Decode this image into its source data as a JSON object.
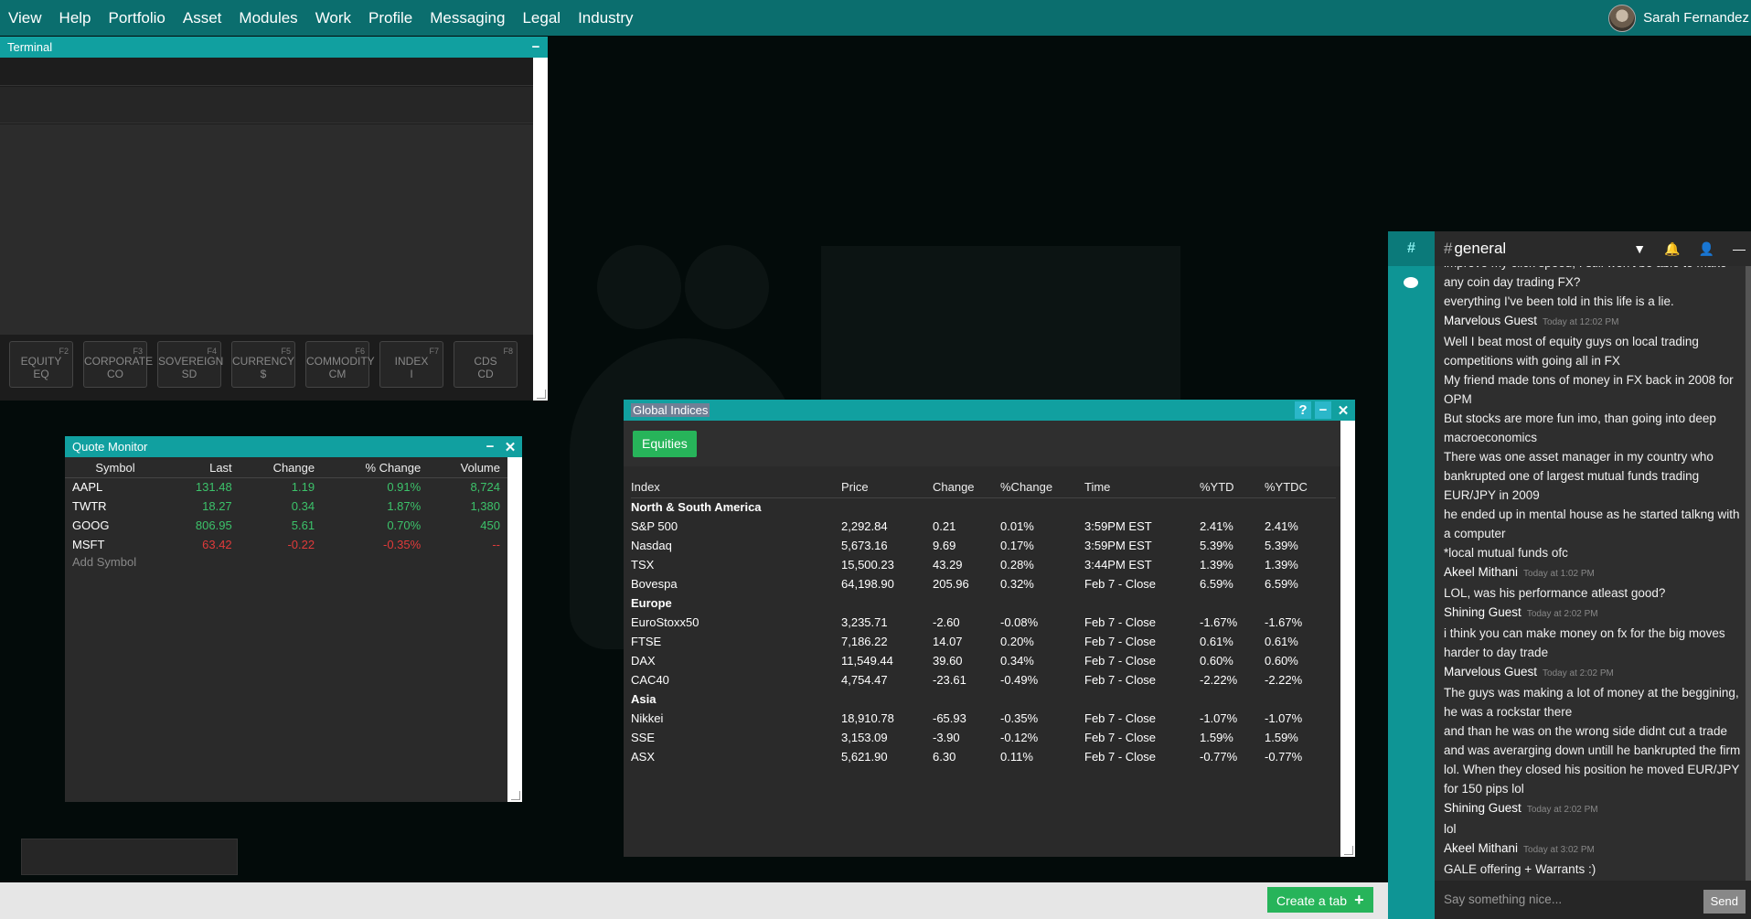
{
  "menu": [
    "View",
    "Help",
    "Portfolio",
    "Asset",
    "Modules",
    "Work",
    "Profile",
    "Messaging",
    "Legal",
    "Industry"
  ],
  "user": {
    "name": "Sarah Fernandez"
  },
  "terminal": {
    "title": "Terminal",
    "fkeys": [
      {
        "key": "F2",
        "line1": "EQUITY",
        "line2": "EQ"
      },
      {
        "key": "F3",
        "line1": "CORPORATE",
        "line2": "CO"
      },
      {
        "key": "F4",
        "line1": "SOVEREIGN",
        "line2": "SD"
      },
      {
        "key": "F5",
        "line1": "CURRENCY",
        "line2": "$"
      },
      {
        "key": "F6",
        "line1": "COMMODITY",
        "line2": "CM"
      },
      {
        "key": "F7",
        "line1": "INDEX",
        "line2": "I"
      },
      {
        "key": "F8",
        "line1": "CDS",
        "line2": "CD"
      }
    ]
  },
  "quote_monitor": {
    "title": "Quote Monitor",
    "columns": [
      "Symbol",
      "Last",
      "Change",
      "% Change",
      "Volume"
    ],
    "rows": [
      {
        "symbol": "AAPL",
        "last": "131.48",
        "change": "1.19",
        "pct": "0.91%",
        "volume": "8,724",
        "dir": "pos"
      },
      {
        "symbol": "TWTR",
        "last": "18.27",
        "change": "0.34",
        "pct": "1.87%",
        "volume": "1,380",
        "dir": "pos"
      },
      {
        "symbol": "GOOG",
        "last": "806.95",
        "change": "5.61",
        "pct": "0.70%",
        "volume": "450",
        "dir": "pos"
      },
      {
        "symbol": "MSFT",
        "last": "63.42",
        "change": "-0.22",
        "pct": "-0.35%",
        "volume": "--",
        "dir": "neg"
      }
    ],
    "add_symbol": "Add Symbol"
  },
  "global_indices": {
    "title": "Global Indices",
    "tab": "Equities",
    "columns": [
      "Index",
      "Price",
      "Change",
      "%Change",
      "Time",
      "%YTD",
      "%YTDC"
    ],
    "groups": [
      {
        "region": "North & South America",
        "rows": [
          {
            "name": "S&P 500",
            "price": "2,292.84",
            "change": "0.21",
            "pct": "0.01%",
            "time": "3:59PM EST",
            "ytd": "2.41%",
            "ytdc": "2.41%",
            "dir": "pos",
            "ydir": "pos"
          },
          {
            "name": "Nasdaq",
            "price": "5,673.16",
            "change": "9.69",
            "pct": "0.17%",
            "time": "3:59PM EST",
            "ytd": "5.39%",
            "ytdc": "5.39%",
            "dir": "pos",
            "ydir": "pos"
          },
          {
            "name": "TSX",
            "price": "15,500.23",
            "change": "43.29",
            "pct": "0.28%",
            "time": "3:44PM EST",
            "ytd": "1.39%",
            "ytdc": "1.39%",
            "dir": "pos",
            "ydir": "pos"
          },
          {
            "name": "Bovespa",
            "price": "64,198.90",
            "change": "205.96",
            "pct": "0.32%",
            "time": "Feb 7 - Close",
            "ytd": "6.59%",
            "ytdc": "6.59%",
            "dir": "pos",
            "ydir": "pos"
          }
        ]
      },
      {
        "region": "Europe",
        "rows": [
          {
            "name": "EuroStoxx50",
            "price": "3,235.71",
            "change": "-2.60",
            "pct": "-0.08%",
            "time": "Feb 7 - Close",
            "ytd": "-1.67%",
            "ytdc": "-1.67%",
            "dir": "neg",
            "ydir": "neg"
          },
          {
            "name": "FTSE",
            "price": "7,186.22",
            "change": "14.07",
            "pct": "0.20%",
            "time": "Feb 7 - Close",
            "ytd": "0.61%",
            "ytdc": "0.61%",
            "dir": "pos",
            "ydir": "pos"
          },
          {
            "name": "DAX",
            "price": "11,549.44",
            "change": "39.60",
            "pct": "0.34%",
            "time": "Feb 7 - Close",
            "ytd": "0.60%",
            "ytdc": "0.60%",
            "dir": "pos",
            "ydir": "pos"
          },
          {
            "name": "CAC40",
            "price": "4,754.47",
            "change": "-23.61",
            "pct": "-0.49%",
            "time": "Feb 7 - Close",
            "ytd": "-2.22%",
            "ytdc": "-2.22%",
            "dir": "neg",
            "ydir": "neg"
          }
        ]
      },
      {
        "region": "Asia",
        "rows": [
          {
            "name": "Nikkei",
            "price": "18,910.78",
            "change": "-65.93",
            "pct": "-0.35%",
            "time": "Feb 7 - Close",
            "ytd": "-1.07%",
            "ytdc": "-1.07%",
            "dir": "neg",
            "ydir": "neg"
          },
          {
            "name": "SSE",
            "price": "3,153.09",
            "change": "-3.90",
            "pct": "-0.12%",
            "time": "Feb 7 - Close",
            "ytd": "1.59%",
            "ytdc": "1.59%",
            "dir": "neg",
            "ydir": "pos"
          },
          {
            "name": "ASX",
            "price": "5,621.90",
            "change": "6.30",
            "pct": "0.11%",
            "time": "Feb 7 - Close",
            "ytd": "-0.77%",
            "ytdc": "-0.77%",
            "dir": "pos",
            "ydir": "neg"
          }
        ]
      }
    ]
  },
  "chat": {
    "channel": "general",
    "messages": [
      {
        "text": "improve my click speed, I still won't be able to make"
      },
      {
        "text": "any coin day trading FX?"
      },
      {
        "text": "everything I've been told in this life is a lie."
      },
      {
        "author": "Marvelous Guest",
        "time": "Today at 12:02 PM"
      },
      {
        "text": "Well I beat most of equity guys on local trading competitions with going all in FX"
      },
      {
        "text": "My friend made tons of money in FX back in 2008 for OPM"
      },
      {
        "text": "But stocks are more fun imo, than going into deep macroeconomics"
      },
      {
        "text": "There was one asset manager in my country who bankrupted one of largest mutual funds trading EUR/JPY in 2009"
      },
      {
        "text": "he ended up in mental house as he started talkng with a computer"
      },
      {
        "text": "*local mutual funds ofc"
      },
      {
        "author": "Akeel Mithani",
        "time": "Today at 1:02 PM"
      },
      {
        "text": "LOL, was his performance atleast good?"
      },
      {
        "author": "Shining Guest",
        "time": "Today at 2:02 PM"
      },
      {
        "text": "i think you can make money on fx for the big moves harder to day trade"
      },
      {
        "author": "Marvelous Guest",
        "time": "Today at 2:02 PM"
      },
      {
        "text": "The guys was making a lot of money at the beggining, he was a rockstar there"
      },
      {
        "text": "and than he was on the wrong side didnt cut a trade and was averarging down untill he bankrupted the firm lol. When they closed his position he moved EUR/JPY for 150 pips lol"
      },
      {
        "author": "Shining Guest",
        "time": "Today at 2:02 PM"
      },
      {
        "text": "lol"
      },
      {
        "author": "Akeel Mithani",
        "time": "Today at 3:02 PM"
      },
      {
        "text": "GALE offering + Warrants :)"
      }
    ],
    "placeholder": "Say something nice...",
    "send": "Send"
  },
  "footer": {
    "create_tab": "Create a tab"
  },
  "colors": {
    "brand": "#0b6e6e",
    "title": "#11a0a0",
    "positive": "#3cc26a",
    "negative": "#e03a3a",
    "accent_button": "#27b45a"
  }
}
